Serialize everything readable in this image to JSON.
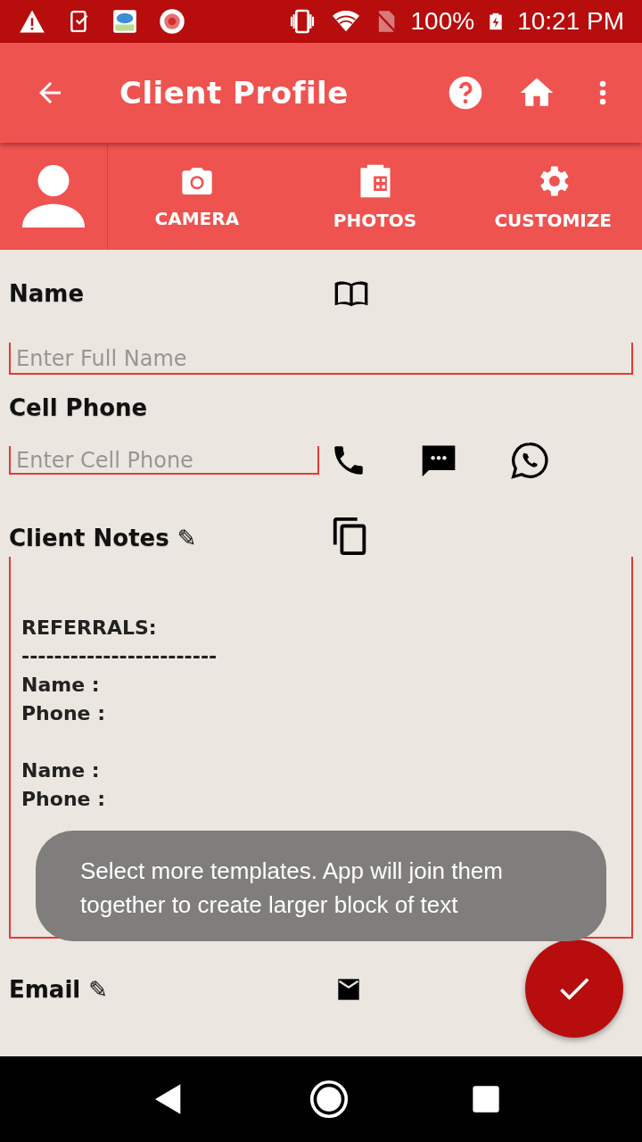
{
  "status_bar": {
    "battery": "100%",
    "time": "10:21 PM"
  },
  "app_bar": {
    "title": "Client Profile"
  },
  "tabs": [
    {
      "label": "CAMERA",
      "kind": "camera"
    },
    {
      "label": "PHOTOS",
      "kind": "photos"
    },
    {
      "label": "CUSTOMIZE",
      "kind": "settings"
    }
  ],
  "fields": {
    "name": {
      "label": "Name",
      "placeholder": "Enter Full Name"
    },
    "cell_phone": {
      "label": "Cell Phone",
      "placeholder": "Enter Cell Phone"
    },
    "client_notes": {
      "label": "Client Notes ✎",
      "value": "REFERRALS:\n------------------------\nName :\nPhone :\n\nName :\nPhone :"
    },
    "email": {
      "label": "Email ✎"
    }
  },
  "toast": {
    "message": "Select more templates. App will join them together to create larger block of text"
  }
}
